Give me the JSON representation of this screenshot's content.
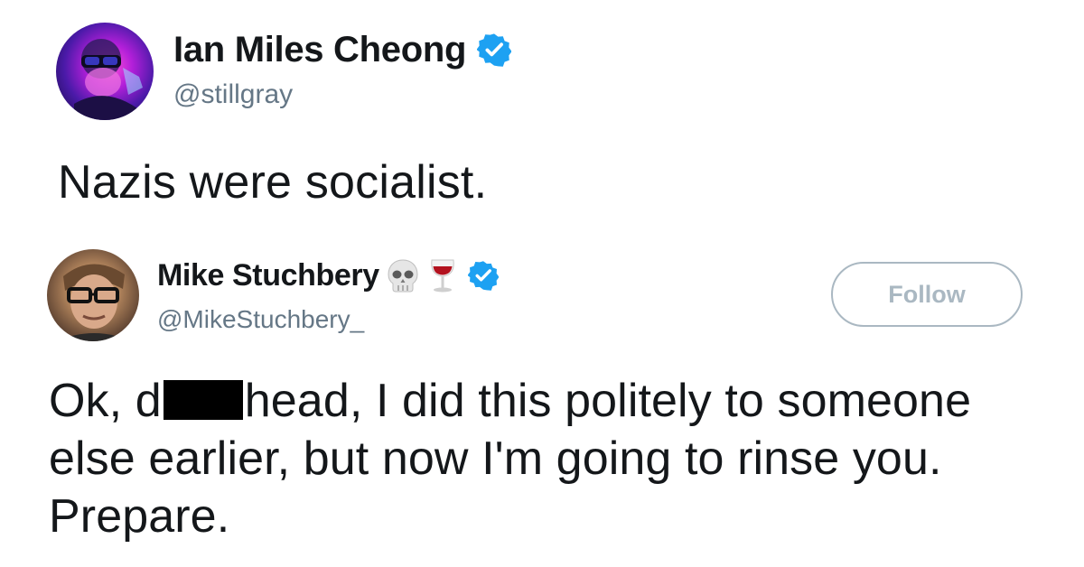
{
  "tweet_1": {
    "display_name": "Ian Miles Cheong",
    "handle": "@stillgray",
    "verified": true,
    "text": "Nazis were socialist."
  },
  "tweet_2": {
    "display_name": "Mike Stuchbery",
    "name_emojis": [
      "skull-icon",
      "wine-glass-icon"
    ],
    "handle": "@MikeStuchbery_",
    "verified": true,
    "follow_label": "Follow",
    "text_start": "Ok, d",
    "text_end": "head, I did this politely to someone else earlier, but now I'm going to rinse you. Prepare."
  },
  "colors": {
    "verified_blue": "#1da1f2",
    "handle_gray": "#657786",
    "follow_border": "#aab8c2",
    "text": "#14171a"
  }
}
